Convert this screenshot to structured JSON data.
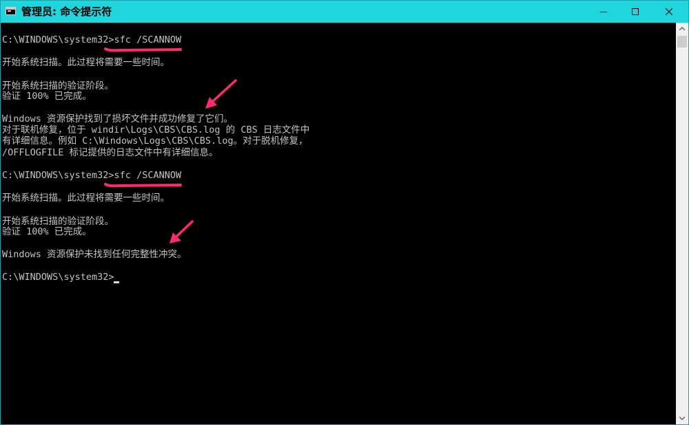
{
  "window": {
    "title": "管理员: 命令提示符",
    "app_icon": "cmd-console-icon",
    "controls": [
      "minimize-icon",
      "maximize-icon",
      "close-icon"
    ]
  },
  "console": {
    "lines": [
      "C:\\WINDOWS\\system32>sfc /SCANNOW",
      "开始系统扫描。此过程将需要一些时间。",
      "开始系统扫描的验证阶段。",
      "验证 100% 已完成。",
      "Windows 资源保护找到了损坏文件并成功修复了它们。",
      "对于联机修复，位于 windir\\Logs\\CBS\\CBS.log 的 CBS 日志文件中",
      "有详细信息。例如 C:\\Windows\\Logs\\CBS\\CBS.log。对于脱机修复，",
      "/OFFLOGFILE 标记提供的日志文件中有详细信息。",
      "C:\\WINDOWS\\system32>sfc /SCANNOW",
      "开始系统扫描。此过程将需要一些时间。",
      "开始系统扫描的验证阶段。",
      "验证 100% 已完成。",
      "Windows 资源保护未找到任何完整性冲突。",
      "C:\\WINDOWS\\system32>"
    ]
  },
  "colors": {
    "titlebar": "#1fd6de",
    "console_bg": "#000000",
    "console_text": "#c4c4c4",
    "annotation": "#ff2a6d"
  }
}
